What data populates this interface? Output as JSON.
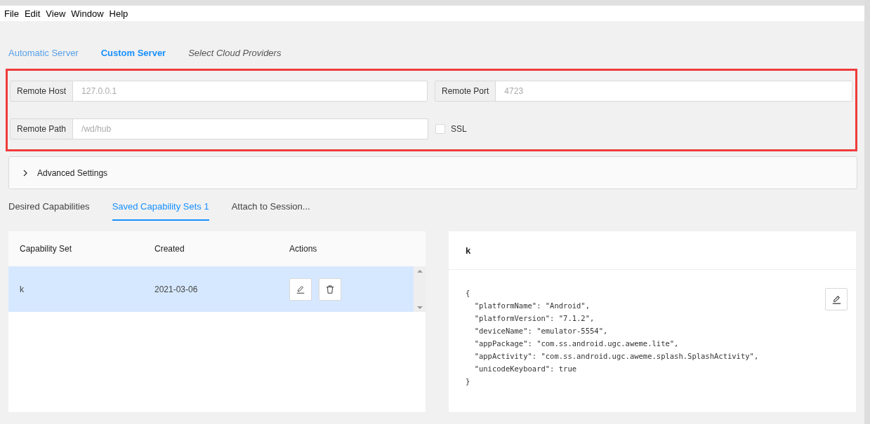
{
  "menu": [
    "File",
    "Edit",
    "View",
    "Window",
    "Help"
  ],
  "server_tabs": [
    {
      "label": "Automatic Server",
      "selected": false,
      "italic": false
    },
    {
      "label": "Custom Server",
      "selected": true,
      "italic": false
    },
    {
      "label": "Select Cloud Providers",
      "selected": false,
      "italic": true
    }
  ],
  "fields": [
    {
      "label": "Remote Host",
      "placeholder": "127.0.0.1"
    },
    {
      "label": "Remote Port",
      "placeholder": "4723"
    },
    {
      "label": "Remote Path",
      "placeholder": "/wd/hub"
    }
  ],
  "ssl": {
    "label": "SSL",
    "checked": false
  },
  "advanced": {
    "label": "Advanced Settings",
    "expanded": false
  },
  "capability_tabs": [
    {
      "label": "Desired Capabilities",
      "selected": false
    },
    {
      "label": "Saved Capability Sets 1",
      "selected": true
    },
    {
      "label": "Attach to Session...",
      "selected": false
    }
  ],
  "table": {
    "columns": [
      "Capability Set",
      "Created",
      "Actions"
    ],
    "rows": [
      {
        "name": "k",
        "created": "2021-03-06",
        "selected": true
      }
    ]
  },
  "detail": {
    "title": "k",
    "code": [
      "{",
      "  \"platformName\": \"Android\",",
      "  \"platformVersion\": \"7.1.2\",",
      "  \"deviceName\": \"emulator-5554\",",
      "  \"appPackage\": \"com.ss.android.ugc.aweme.lite\",",
      "  \"appActivity\": \"com.ss.android.ugc.aweme.splash.SplashActivity\",",
      "  \"unicodeKeyboard\": true",
      "}"
    ]
  }
}
